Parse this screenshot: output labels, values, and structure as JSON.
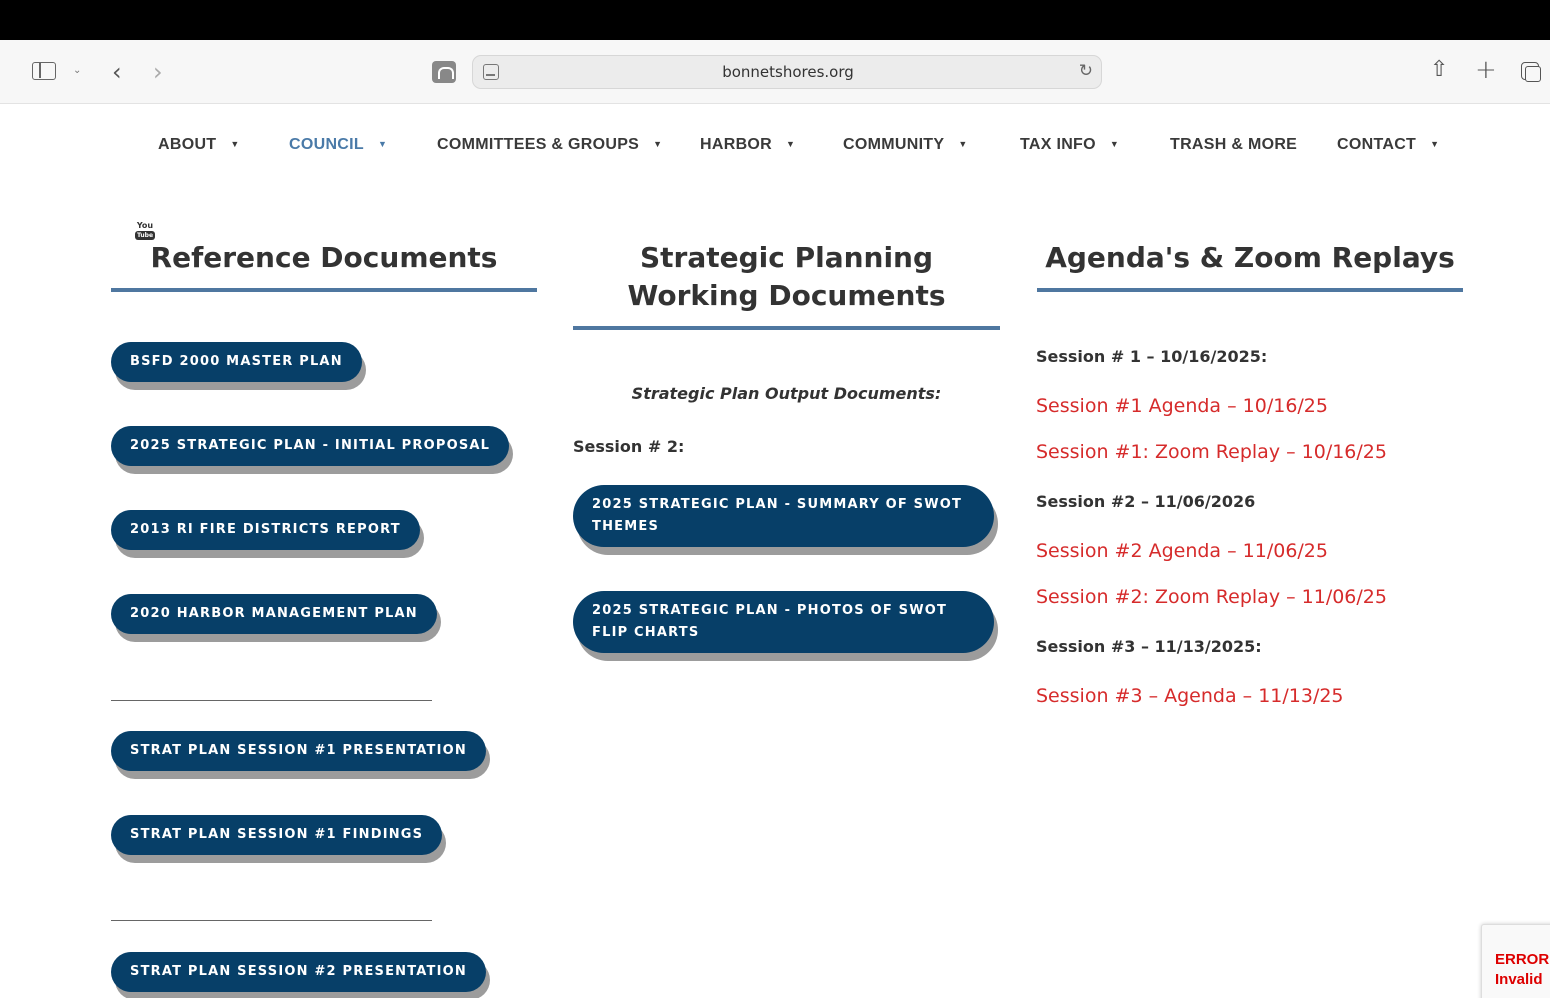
{
  "browser": {
    "url": "bonnetshores.org"
  },
  "nav": {
    "items": [
      {
        "label": "ABOUT"
      },
      {
        "label": "COUNCIL"
      },
      {
        "label": "COMMITTEES & GROUPS"
      },
      {
        "label": "HARBOR"
      },
      {
        "label": "COMMUNITY"
      },
      {
        "label": "TAX INFO"
      },
      {
        "label": "TRASH & MORE"
      },
      {
        "label": "CONTACT"
      }
    ]
  },
  "reference": {
    "title": "Reference Documents",
    "youtube_top": "You",
    "youtube_bottom": "Tube",
    "buttons": [
      "BSFD 2000 MASTER PLAN",
      "2025 STRATEGIC PLAN - INITIAL PROPOSAL",
      "2013 RI FIRE DISTRICTS REPORT",
      "2020 HARBOR MANAGEMENT PLAN",
      "STRAT PLAN SESSION #1 PRESENTATION",
      "STRAT PLAN SESSION #1 FINDINGS",
      "STRAT PLAN SESSION #2 PRESENTATION"
    ]
  },
  "strategic": {
    "title": "Strategic Planning Working Documents",
    "subtitle": "Strategic Plan Output Documents:",
    "session_label": "Session # 2:",
    "buttons": [
      "2025 STRATEGIC PLAN - SUMMARY OF SWOT THEMES",
      "2025 STRATEGIC PLAN - PHOTOS OF SWOT FLIP CHARTS"
    ]
  },
  "agendas": {
    "title": "Agenda's & Zoom Replays",
    "session1_label": "Session # 1 – 10/16/2025:",
    "session1_agenda": "Session #1 Agenda – 10/16/25",
    "session1_replay": "Session #1: Zoom Replay – 10/16/25",
    "session2_label": "Session #2 – 11/06/2026",
    "session2_agenda": "Session #2 Agenda – 11/06/25",
    "session2_replay": "Session #2: Zoom Replay – 11/06/25",
    "session3_label": "Session #3 – 11/13/2025:",
    "session3_agenda": "Session #3 – Agenda – 11/13/25"
  },
  "recaptcha": {
    "line1": "ERROR",
    "line2": "Invalid"
  },
  "colors": {
    "button_bg": "#073f68",
    "link_red": "#d62b2b",
    "nav_active": "#4a7aa8",
    "rule": "#4f77a0"
  }
}
